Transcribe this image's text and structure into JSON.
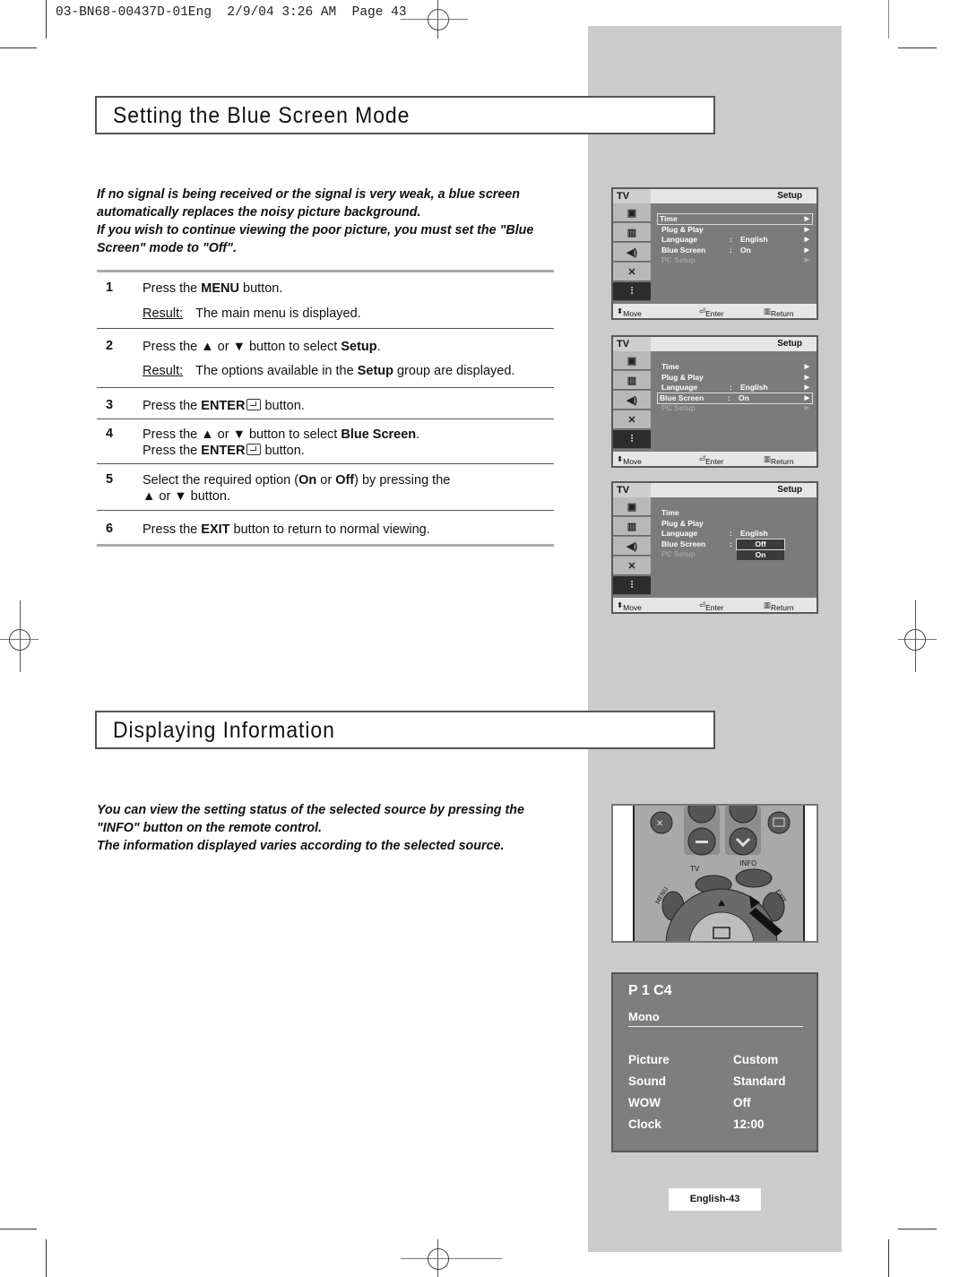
{
  "print_header": "03-BN68-00437D-01Eng  2/9/04 3:26 AM  Page 43",
  "section1": {
    "title": "Setting the Blue Screen Mode",
    "intro": [
      "If no signal is being received or the signal is very weak, a blue screen automatically replaces the noisy picture background.",
      "If you wish to continue viewing the poor picture, you must set the \"Blue Screen\" mode to \"Off\"."
    ],
    "steps": [
      {
        "num": "1",
        "pre": "Press the ",
        "bold": "MENU",
        "post": " button.",
        "result_label": "Result:",
        "result_pre": "The main menu is displayed.",
        "result_bold": "",
        "result_post": ""
      },
      {
        "num": "2",
        "pre": "Press the ▲ or ▼ button to select ",
        "bold": "Setup",
        "post": ".",
        "result_label": "Result:",
        "result_pre": "The options available in the ",
        "result_bold": "Setup",
        "result_post": " group are displayed."
      },
      {
        "num": "3",
        "pre": "Press the ",
        "bold": "ENTER",
        "post": " button."
      },
      {
        "num": "4",
        "pre": "Press the ▲ or ▼ button to select ",
        "bold": "Blue Screen",
        "post": ".",
        "line2_pre": "Press the ",
        "line2_bold": "ENTER",
        "line2_post": " button."
      },
      {
        "num": "5",
        "pre": "Select the required option (",
        "bold": "On",
        "mid": " or ",
        "bold2": "Off",
        "post": ") by pressing the",
        "line2": "▲ or ▼ button."
      },
      {
        "num": "6",
        "pre": "Press the ",
        "bold": "EXIT",
        "post": " button to return to normal viewing."
      }
    ]
  },
  "osd_menus": [
    {
      "source": "TV",
      "title": "Setup",
      "items": [
        {
          "label": "Time",
          "sep": "",
          "value": "",
          "arrow": "▶",
          "highlight": true,
          "dim": false
        },
        {
          "label": "Plug & Play",
          "sep": "",
          "value": "",
          "arrow": "▶",
          "highlight": false,
          "dim": false
        },
        {
          "label": "Language",
          "sep": ":",
          "value": "English",
          "arrow": "▶",
          "highlight": false,
          "dim": false
        },
        {
          "label": "Blue Screen",
          "sep": ":",
          "value": "On",
          "arrow": "▶",
          "highlight": false,
          "dim": false
        },
        {
          "label": "PC Setup",
          "sep": "",
          "value": "",
          "arrow": "▶",
          "highlight": false,
          "dim": true
        }
      ],
      "footer": {
        "move": "Move",
        "enter": "Enter",
        "return": "Return"
      }
    },
    {
      "source": "TV",
      "title": "Setup",
      "items": [
        {
          "label": "Time",
          "sep": "",
          "value": "",
          "arrow": "▶",
          "highlight": false,
          "dim": false
        },
        {
          "label": "Plug & Play",
          "sep": "",
          "value": "",
          "arrow": "▶",
          "highlight": false,
          "dim": false
        },
        {
          "label": "Language",
          "sep": ":",
          "value": "English",
          "arrow": "▶",
          "highlight": false,
          "dim": false
        },
        {
          "label": "Blue Screen",
          "sep": ":",
          "value": "On",
          "arrow": "▶",
          "highlight": true,
          "dim": false
        },
        {
          "label": "PC Setup",
          "sep": "",
          "value": "",
          "arrow": "▶",
          "highlight": false,
          "dim": true
        }
      ],
      "footer": {
        "move": "Move",
        "enter": "Enter",
        "return": "Return"
      }
    },
    {
      "source": "TV",
      "title": "Setup",
      "items": [
        {
          "label": "Time",
          "sep": "",
          "value": "",
          "arrow": "",
          "highlight": false,
          "dim": false
        },
        {
          "label": "Plug & Play",
          "sep": "",
          "value": "",
          "arrow": "",
          "highlight": false,
          "dim": false
        },
        {
          "label": "Language",
          "sep": ":",
          "value": "English",
          "arrow": "",
          "highlight": false,
          "dim": false
        },
        {
          "label": "Blue Screen",
          "sep": ":",
          "value": "",
          "arrow": "",
          "highlight": false,
          "dim": false
        },
        {
          "label": "PC Setup",
          "sep": "",
          "value": "",
          "arrow": "",
          "highlight": false,
          "dim": true
        }
      ],
      "dropdown": [
        "Off",
        "On"
      ],
      "dropdown_selected": "Off",
      "footer": {
        "move": "Move",
        "enter": "Enter",
        "return": "Return"
      }
    }
  ],
  "section2": {
    "title": "Displaying Information",
    "intro": [
      "You can view the setting status of the selected source by pressing the \"INFO\" button on the remote control.",
      "The information displayed varies according to the selected source."
    ]
  },
  "remote": {
    "labels": {
      "tv": "TV",
      "info": "INFO",
      "menu": "MENU",
      "exit": "EXIT"
    }
  },
  "info_box": {
    "channel": "P 1   C4",
    "audio": "Mono",
    "rows": [
      {
        "key": "Picture",
        "value": "Custom"
      },
      {
        "key": "Sound",
        "value": "Standard"
      },
      {
        "key": "WOW",
        "value": "Off"
      },
      {
        "key": "Clock",
        "value": "12:00"
      }
    ]
  },
  "page_number": "English-43"
}
